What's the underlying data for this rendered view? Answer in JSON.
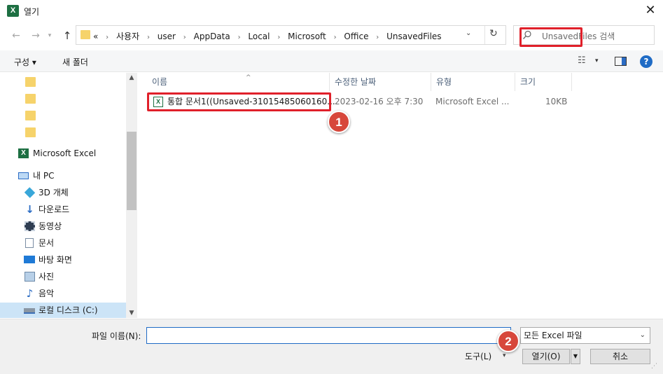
{
  "window": {
    "title": "열기",
    "app_icon_letter": "X",
    "close_glyph": "✕"
  },
  "navigation": {
    "back_glyph": "←",
    "forward_glyph": "→",
    "recent_glyph": "▾",
    "up_glyph": "↑"
  },
  "address": {
    "prefix": "«",
    "crumbs": [
      "사용자",
      "user",
      "AppData",
      "Local",
      "Microsoft",
      "Office",
      "UnsavedFiles"
    ],
    "separator": "›",
    "dropdown_glyph": "⌄",
    "refresh_glyph": "↻"
  },
  "search": {
    "placeholder": "UnsavedFiles 검색",
    "icon": "search-icon"
  },
  "toolbar": {
    "organize_label": "구성 ▾",
    "new_folder_label": "새 폴더",
    "view_glyph": "☷",
    "view_dd_glyph": "▾",
    "help_glyph": "?"
  },
  "nav_pane": {
    "folders": [
      "",
      "",
      "",
      ""
    ],
    "excel_label": "Microsoft Excel",
    "pc_label": "내 PC",
    "items": [
      {
        "label": "3D 개체",
        "icon": "3d-objects-icon"
      },
      {
        "label": "다운로드",
        "icon": "download-icon"
      },
      {
        "label": "동영상",
        "icon": "video-icon"
      },
      {
        "label": "문서",
        "icon": "document-icon"
      },
      {
        "label": "바탕 화면",
        "icon": "desktop-icon"
      },
      {
        "label": "사진",
        "icon": "picture-icon"
      },
      {
        "label": "음악",
        "icon": "music-icon"
      },
      {
        "label": "로컬 디스크 (C:)",
        "icon": "drive-icon"
      }
    ]
  },
  "file_list": {
    "columns": [
      "이름",
      "수정한 날짜",
      "유형",
      "크기"
    ],
    "rows": [
      {
        "name": "통합 문서1((Unsaved-31015485060160...",
        "modified": "2023-02-16 오후 7:30",
        "type": "Microsoft Excel ...",
        "size": "10KB"
      }
    ]
  },
  "annotations": {
    "badge1": "1",
    "badge2": "2",
    "highlight_color": "#e0202a",
    "badge_color": "#d7473b"
  },
  "bottom": {
    "filename_label": "파일 이름(N):",
    "filename_value": "",
    "filetype_value": "모든 Excel 파일",
    "tools_label": "도구(L)",
    "open_label": "열기(O)",
    "cancel_label": "취소"
  }
}
